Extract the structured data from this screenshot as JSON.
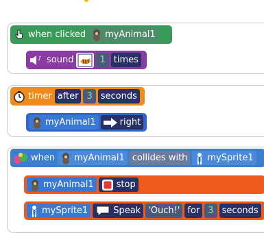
{
  "blocks": {
    "click_event": {
      "label": "when clicked",
      "target": "myAnimal1"
    },
    "sound": {
      "label": "sound",
      "count": "1",
      "unit": "times"
    },
    "timer": {
      "label": "timer",
      "after": "after",
      "value": "3",
      "unit": "seconds"
    },
    "move": {
      "target": "myAnimal1",
      "direction": "right"
    },
    "collide": {
      "when": "when",
      "subject": "myAnimal1",
      "verb": "collides with",
      "object": "mySprite1"
    },
    "stop": {
      "target": "myAnimal1",
      "label": "stop"
    },
    "speak": {
      "target": "mySprite1",
      "label": "Speak",
      "text": "'Ouch!'",
      "for": "for",
      "value": "3",
      "unit": "seconds"
    }
  },
  "colors": {
    "event_green": "#3a9a5a",
    "sound_purple": "#8b3aa6",
    "timer_orange": "#f08a1b",
    "motion_blue": "#2f66c8",
    "collide_blue": "#3a7fd0",
    "stop_orange": "#ef5b1d"
  }
}
